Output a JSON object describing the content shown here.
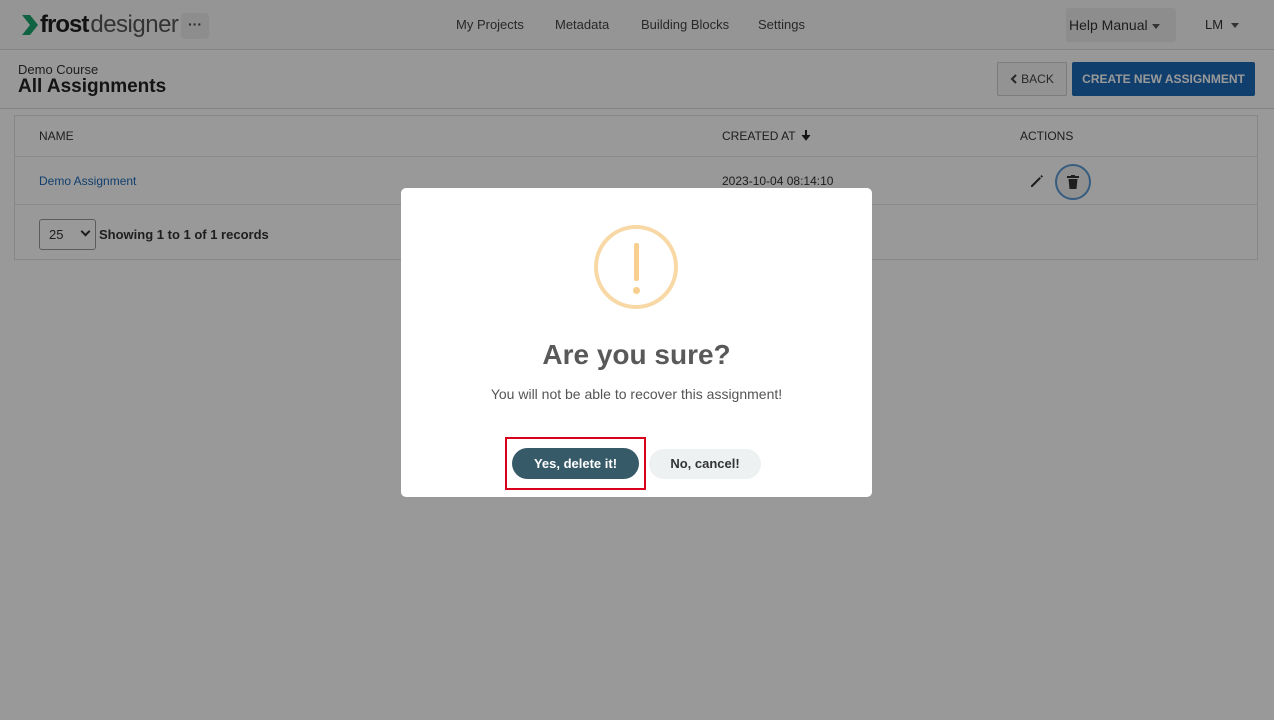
{
  "navbar": {
    "logo_bold": "frost",
    "logo_light": "designer",
    "more_label": "···",
    "links": [
      "My Projects",
      "Metadata",
      "Building Blocks",
      "Settings"
    ],
    "help_label": "Help Manual",
    "user_label": "LM"
  },
  "header": {
    "course": "Demo Course",
    "title": "All Assignments",
    "back_label": "BACK",
    "create_label": "CREATE NEW ASSIGNMENT"
  },
  "table": {
    "columns": [
      "NAME",
      "CREATED AT",
      "ACTIONS"
    ],
    "rows": [
      {
        "name": "Demo Assignment",
        "created_at": "2023-10-04 08:14:10"
      }
    ],
    "page_size": "25",
    "records_text": "Showing 1 to 1 of 1 records"
  },
  "modal": {
    "title": "Are you sure?",
    "text": "You will not be able to recover this assignment!",
    "confirm_label": "Yes, delete it!",
    "cancel_label": "No, cancel!"
  },
  "colors": {
    "brand_green": "#1aa36f",
    "primary_blue": "#1c69b8",
    "confirm_bg": "#375a69",
    "warning": "#f8cf8f",
    "highlight_red": "#d9001b"
  },
  "icons": {
    "logo": "chevron-logo-icon",
    "sort": "arrow-down-icon",
    "edit": "pencil-icon",
    "delete": "trash-icon",
    "warning": "exclamation-icon"
  }
}
